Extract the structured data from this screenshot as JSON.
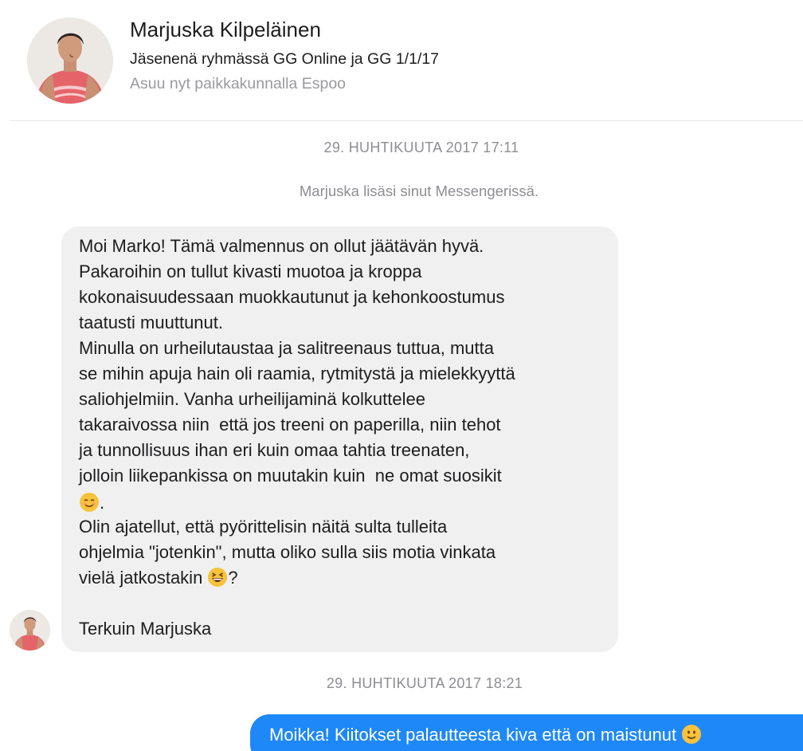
{
  "contact": {
    "name": "Marjuska Kilpeläinen",
    "membership": "Jäsenenä ryhmässä GG Online ja GG 1/1/17",
    "location": "Asuu nyt paikkakunnalla Espoo"
  },
  "conversation": {
    "timestamp_1": "29. HUHTIKUUTA 2017 17:11",
    "system_note": "Marjuska lisäsi sinut Messengerissä.",
    "incoming_message": {
      "lines": [
        "Moi Marko! Tämä valmennus on ollut jäätävän hyvä.",
        "Pakaroihin on tullut kivasti muotoa ja kroppa",
        "kokonaisuudessaan muokkautunut ja kehonkoostumus",
        "taatusti muuttunut.",
        "Minulla on urheilutaustaa ja salitreenaus tuttua, mutta",
        "se mihin apuja hain oli raamia, rytmitystä ja mielekkyyttä",
        "saliohjelmiin. Vanha urheilijaminä kolkuttelee",
        "takaraivossa niin  että jos treeni on paperilla, niin tehot",
        "ja tunnollisuus ihan eri kuin omaa tahtia treenaten,",
        "jolloin liikepankissa on muutakin kuin  ne omat suosikit",
        ".",
        "Olin ajatellut, että pyörittelisin näitä sulta tulleita",
        "ohjelmia \"jotenkin\", mutta oliko sulla siis motia vinkata",
        "vielä jatkostakin ",
        "?",
        "Terkuin Marjuska"
      ],
      "emoji_1": "smiling-face-emoji",
      "emoji_2": "grinning-squinting-face-emoji"
    },
    "timestamp_2": "29. HUHTIKUUTA 2017 18:21",
    "outgoing_message": {
      "text": "Moikka! Kiitokset palautteesta kiva että on maistunut ",
      "emoji": "slightly-smiling-face-emoji"
    }
  },
  "colors": {
    "incoming_bubble": "#f0f0f0",
    "outgoing_bubble": "#1e88f8",
    "meta_text": "#8e8e93",
    "divider": "#e6e6e8"
  }
}
